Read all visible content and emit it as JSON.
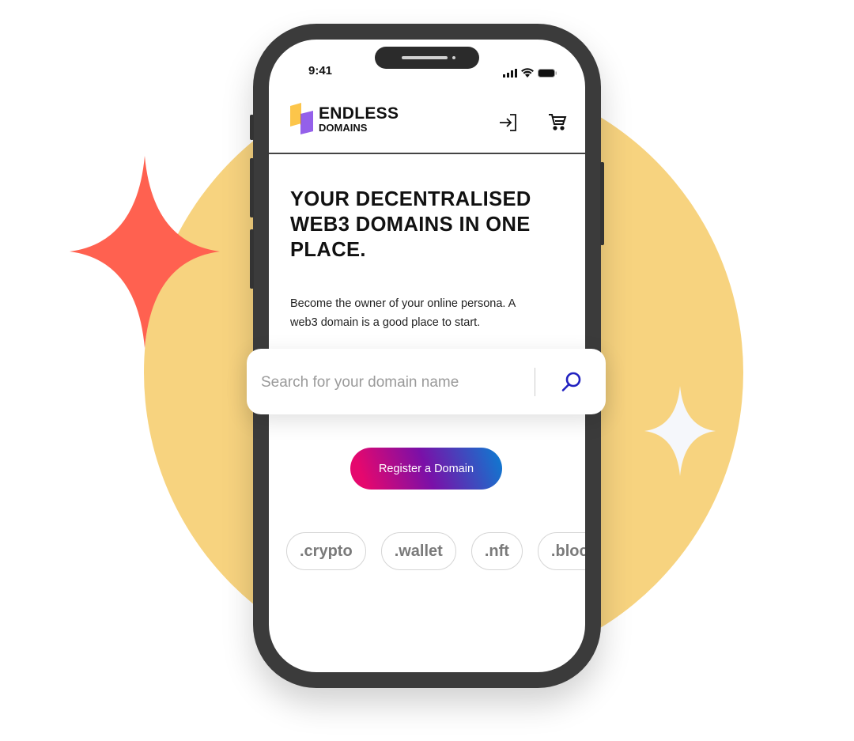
{
  "status_bar": {
    "time": "9:41",
    "icons": [
      "signal-icon",
      "wifi-icon",
      "battery-icon"
    ]
  },
  "header": {
    "logo_line1": "ENDLESS",
    "logo_line2": "DOMAINS",
    "icons": [
      "sign-in-icon",
      "cart-icon"
    ]
  },
  "hero": {
    "title": "YOUR DECENTRALISED WEB3 DOMAINS IN ONE PLACE.",
    "subtitle": "Become the owner of your online persona. A web3 domain is a good place to start."
  },
  "search": {
    "placeholder": "Search for your domain name",
    "value": "",
    "icon": "search-icon"
  },
  "cta": {
    "label": "Register a Domain"
  },
  "chips": [
    ".crypto",
    ".wallet",
    ".nft",
    ".blockchain"
  ],
  "colors": {
    "circle": "#f7d37f",
    "red_star": "#ff6150",
    "search_icon": "#2222c0",
    "cta_gradient": [
      "#e5086e",
      "#7a10a8",
      "#0a7ed2"
    ],
    "logo_yellow": "#fcc54a",
    "logo_purple": "#8b52e8"
  }
}
